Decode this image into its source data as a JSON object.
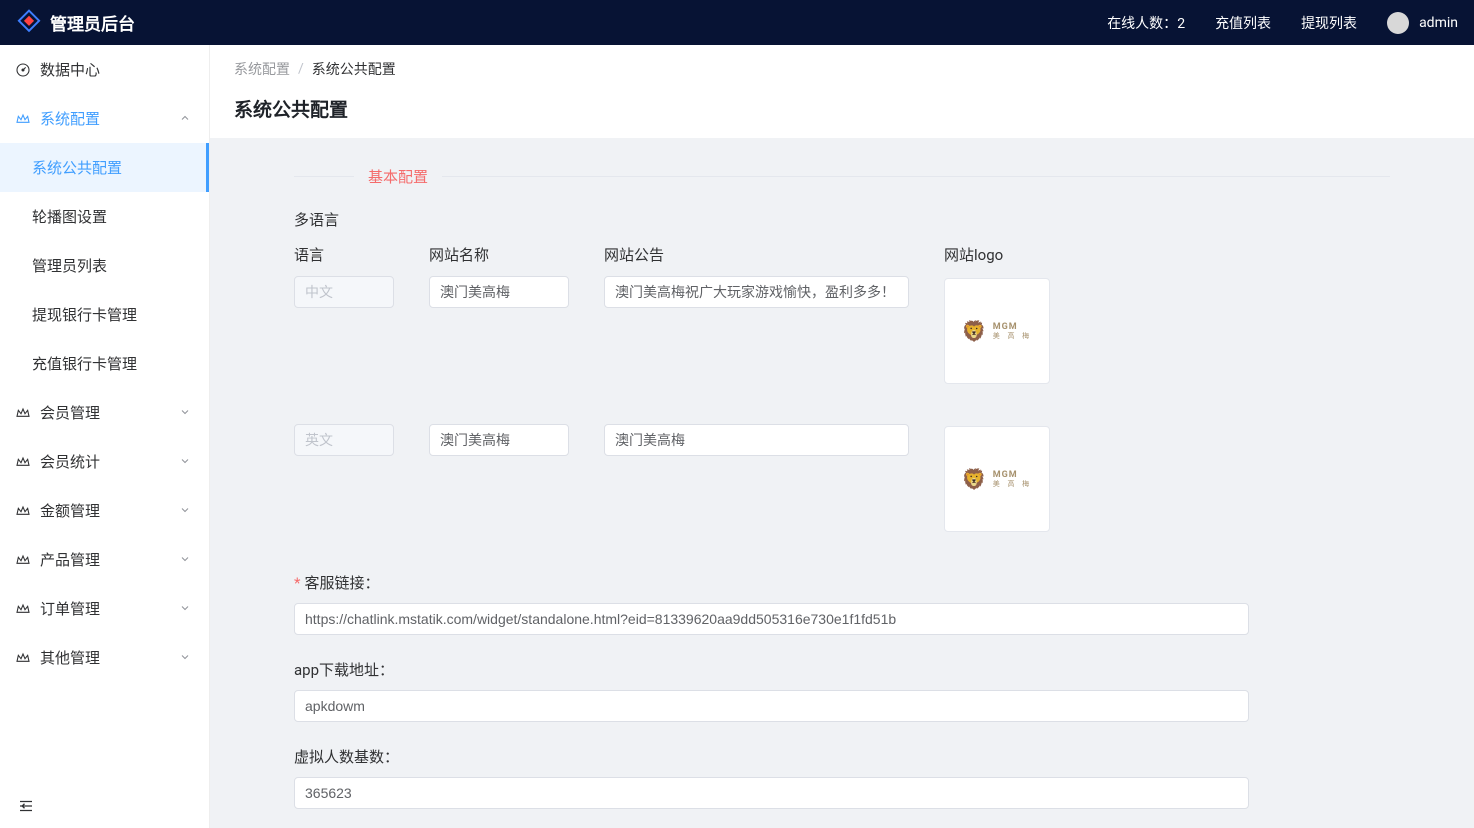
{
  "header": {
    "app_title": "管理员后台",
    "online_label": "在线人数：",
    "online_count": "2",
    "recharge_list": "充值列表",
    "withdraw_list": "提现列表",
    "username": "admin"
  },
  "sidebar": {
    "data_center": "数据中心",
    "sys_config": "系统配置",
    "sys_config_children": {
      "public": "系统公共配置",
      "carousel": "轮播图设置",
      "admins": "管理员列表",
      "withdraw_bank": "提现银行卡管理",
      "recharge_bank": "充值银行卡管理"
    },
    "member_mgmt": "会员管理",
    "member_stats": "会员统计",
    "amount_mgmt": "金额管理",
    "product_mgmt": "产品管理",
    "order_mgmt": "订单管理",
    "other_mgmt": "其他管理"
  },
  "breadcrumb": {
    "parent": "系统配置",
    "current": "系统公共配置"
  },
  "page_title": "系统公共配置",
  "form": {
    "section_basic": "基本配置",
    "multilang_label": "多语言",
    "col_head": {
      "lang": "语言",
      "name": "网站名称",
      "notice": "网站公告",
      "logo": "网站logo"
    },
    "rows": [
      {
        "lang": "中文",
        "name": "澳门美高梅",
        "notice": "澳门美高梅祝广大玩家游戏愉快，盈利多多！"
      },
      {
        "lang": "英文",
        "name": "澳门美高梅",
        "notice": "澳门美高梅"
      }
    ],
    "logo_brand": "MGM",
    "logo_brand_cn": "美 高 梅",
    "service_link_label": "客服链接：",
    "service_link_value": "https://chatlink.mstatik.com/widget/standalone.html?eid=81339620aa9dd505316e730e1f1fd51b",
    "app_download_label": "app下载地址：",
    "app_download_value": "apkdowm",
    "virtual_base_label": "虚拟人数基数：",
    "virtual_base_value": "365623"
  }
}
